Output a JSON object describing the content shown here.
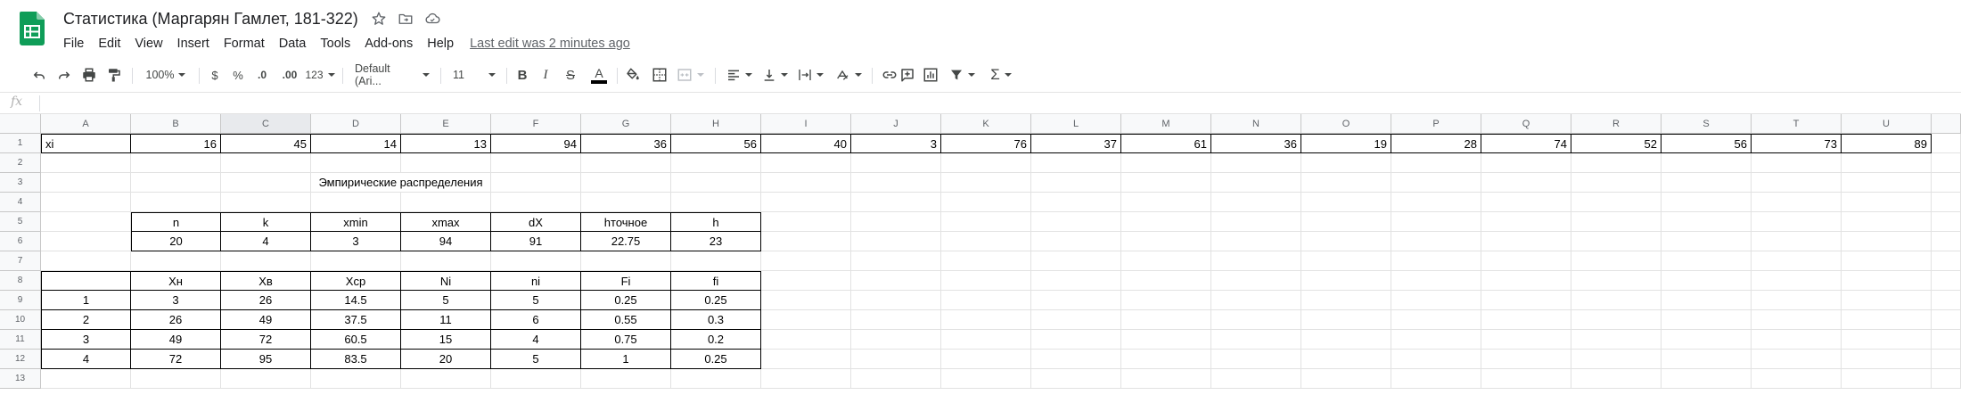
{
  "app": {
    "doc_title": "Статистика (Маргарян Гамлет, 181-322)",
    "last_edit": "Last edit was 2 minutes ago",
    "brand_color": "#0f9d58"
  },
  "menu": [
    "File",
    "Edit",
    "View",
    "Insert",
    "Format",
    "Data",
    "Tools",
    "Add-ons",
    "Help"
  ],
  "toolbar": {
    "zoom": "100%",
    "currency": "$",
    "percent": "%",
    "decrease_decimal": ".0",
    "increase_decimal": ".00",
    "more_formats": "123",
    "font_family": "Default (Ari...",
    "font_size": "11",
    "bold": "B",
    "italic": "I",
    "strikethrough": "S",
    "text_color": "A",
    "sum": "Σ",
    "icons": [
      "undo-icon",
      "redo-icon",
      "print-icon",
      "paint-format-icon",
      "fill-color-icon",
      "borders-icon",
      "merge-cells-icon",
      "align-left-icon",
      "valign-bottom-icon",
      "text-wrap-icon",
      "text-rotate-icon",
      "link-icon",
      "comment-icon",
      "chart-icon",
      "filter-icon",
      "functions-icon"
    ]
  },
  "formula_bar": {
    "label": "fx",
    "value": ""
  },
  "columns": [
    "A",
    "B",
    "C",
    "D",
    "E",
    "F",
    "G",
    "H",
    "I",
    "J",
    "K",
    "L",
    "M",
    "N",
    "O",
    "P",
    "Q",
    "R",
    "S",
    "T",
    "U"
  ],
  "selected_column": "C",
  "rows": [
    "1",
    "2",
    "3",
    "4",
    "5",
    "6",
    "7",
    "8",
    "9",
    "10",
    "11",
    "12",
    "13"
  ],
  "sheet": {
    "row1": {
      "label": "xi",
      "values": [
        "16",
        "45",
        "14",
        "13",
        "94",
        "36",
        "56",
        "40",
        "3",
        "76",
        "37",
        "61",
        "36",
        "19",
        "28",
        "74",
        "52",
        "56",
        "73",
        "89"
      ]
    },
    "section_title": "Эмпирические распределения",
    "params_header": [
      "n",
      "k",
      "xmin",
      "xmax",
      "dX",
      "hточное",
      "h"
    ],
    "params_values": [
      "20",
      "4",
      "3",
      "94",
      "91",
      "22.75",
      "23"
    ],
    "table_header": [
      "Xн",
      "Xв",
      "Xср",
      "Ni",
      "ni",
      "Fi",
      "fi"
    ],
    "table_rows": [
      [
        "1",
        "3",
        "26",
        "14.5",
        "5",
        "5",
        "0.25",
        "0.25"
      ],
      [
        "2",
        "26",
        "49",
        "37.5",
        "11",
        "6",
        "0.55",
        "0.3"
      ],
      [
        "3",
        "49",
        "72",
        "60.5",
        "15",
        "4",
        "0.75",
        "0.2"
      ],
      [
        "4",
        "72",
        "95",
        "83.5",
        "20",
        "5",
        "1",
        "0.25"
      ]
    ]
  }
}
